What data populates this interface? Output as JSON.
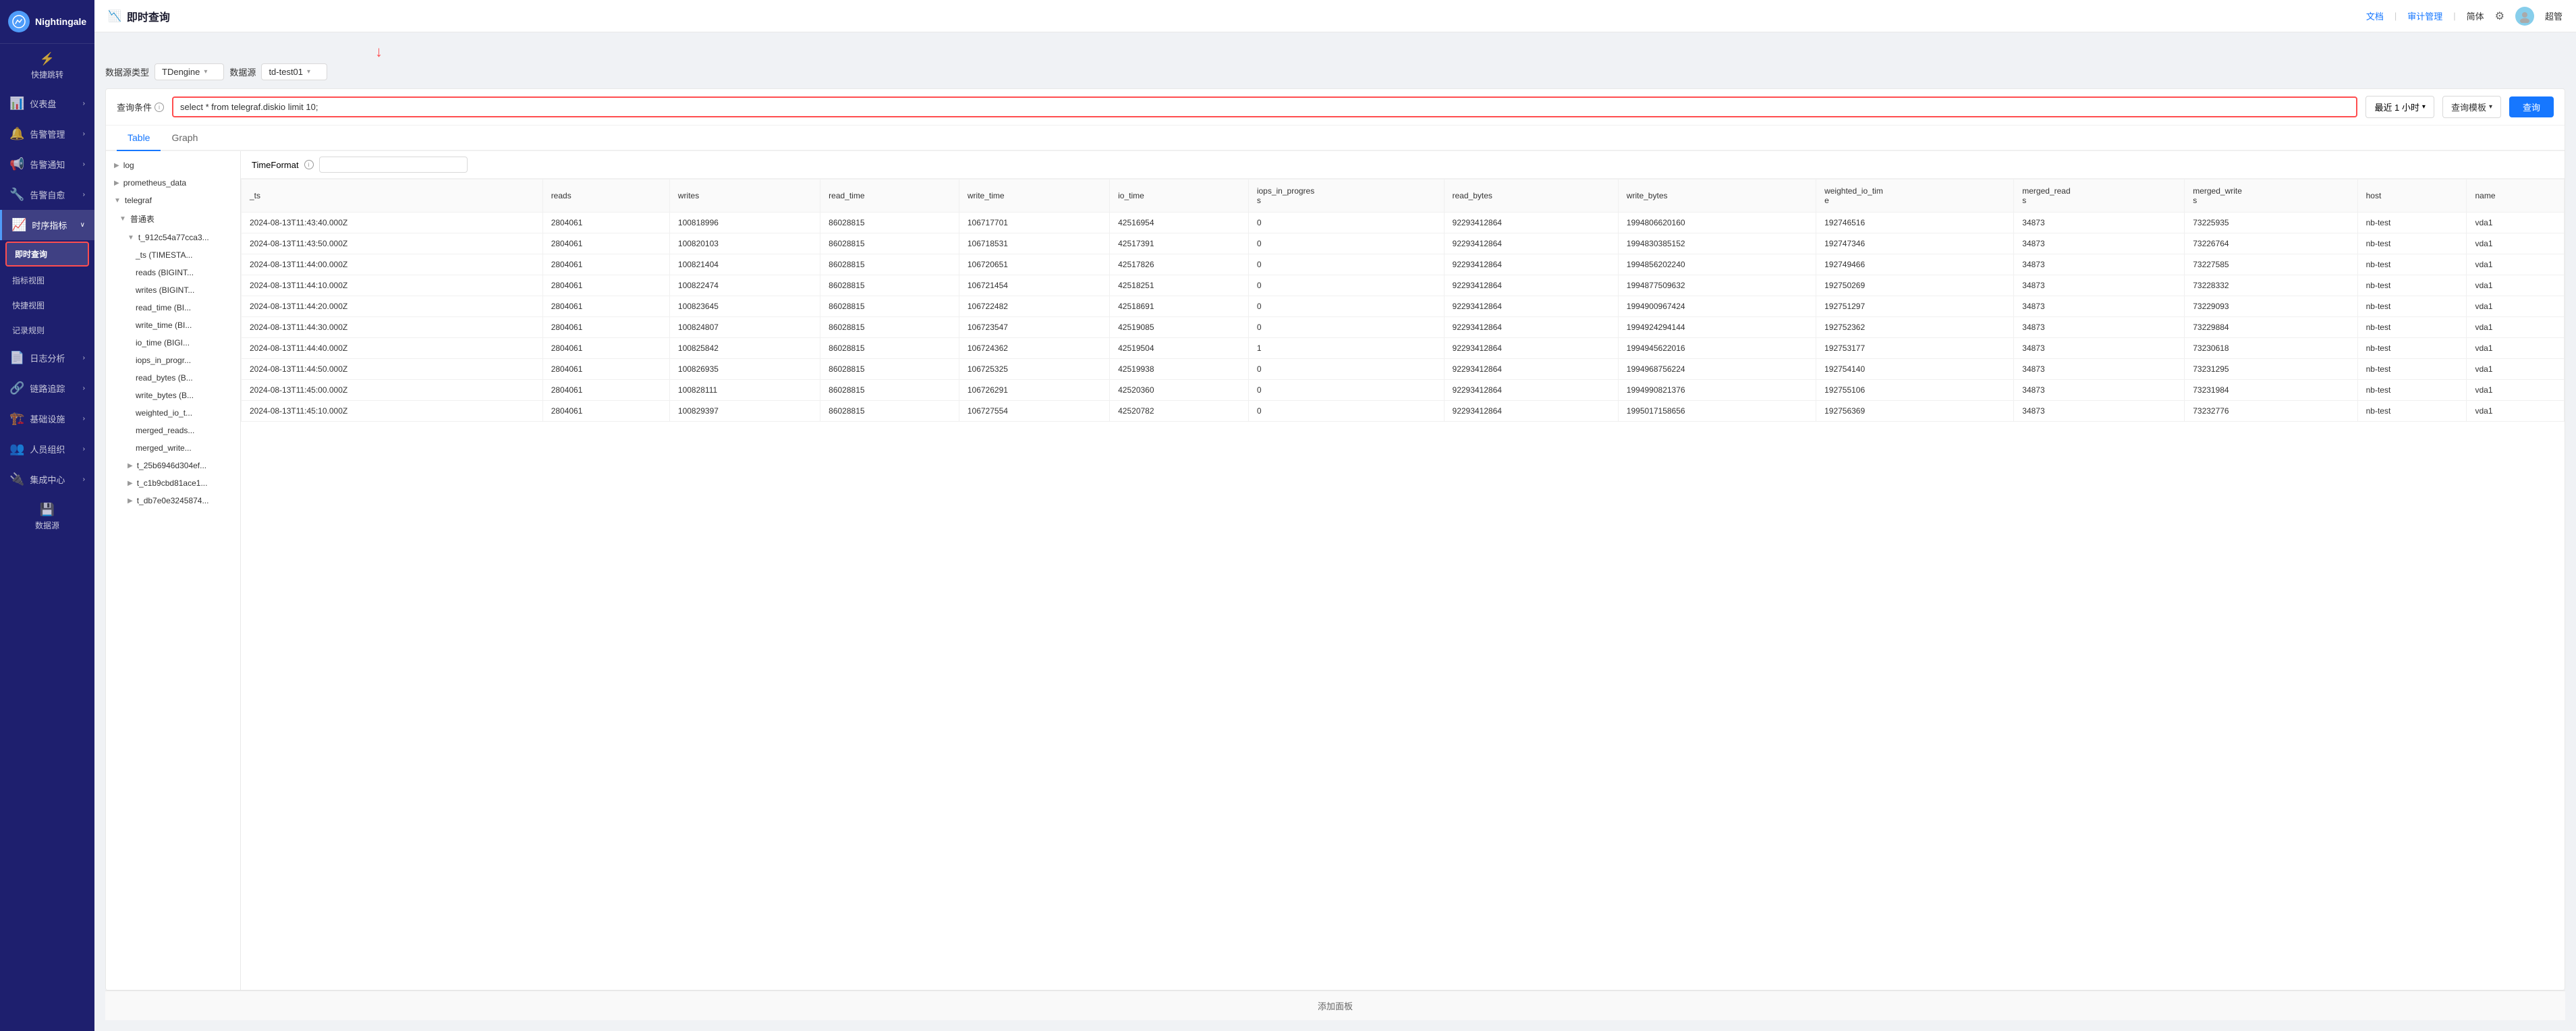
{
  "app": {
    "name": "Nightingale",
    "logo_letter": "N"
  },
  "sidebar": {
    "items": [
      {
        "id": "quick-jump",
        "label": "快捷跳转",
        "icon": "⚡",
        "active": false,
        "has_submenu": false
      },
      {
        "id": "dashboard",
        "label": "仪表盘",
        "icon": "📊",
        "active": false,
        "has_submenu": true
      },
      {
        "id": "alert-mgmt",
        "label": "告警管理",
        "icon": "🔔",
        "active": false,
        "has_submenu": true
      },
      {
        "id": "alert-notify",
        "label": "告警通知",
        "icon": "📢",
        "active": false,
        "has_submenu": true
      },
      {
        "id": "alert-self",
        "label": "告警自愈",
        "icon": "🔧",
        "active": false,
        "has_submenu": true
      },
      {
        "id": "timeseries",
        "label": "时序指标",
        "icon": "📈",
        "active": true,
        "has_submenu": true
      },
      {
        "id": "realtime-query",
        "label": "即时查询",
        "active": true,
        "submenu": true,
        "is_sub": true
      },
      {
        "id": "metric-view",
        "label": "指标视图",
        "active": false,
        "is_sub": true
      },
      {
        "id": "quick-view",
        "label": "快捷视图",
        "active": false,
        "is_sub": true
      },
      {
        "id": "record-rule",
        "label": "记录规则",
        "active": false,
        "is_sub": true
      },
      {
        "id": "log-analysis",
        "label": "日志分析",
        "icon": "📄",
        "active": false,
        "has_submenu": true
      },
      {
        "id": "trace",
        "label": "链路追踪",
        "icon": "🔗",
        "active": false,
        "has_submenu": true
      },
      {
        "id": "infra",
        "label": "基础设施",
        "icon": "🏗️",
        "active": false,
        "has_submenu": true
      },
      {
        "id": "personnel",
        "label": "人员组织",
        "icon": "👥",
        "active": false,
        "has_submenu": true
      },
      {
        "id": "integration",
        "label": "集成中心",
        "icon": "🔌",
        "active": false,
        "has_submenu": true
      },
      {
        "id": "datasource",
        "label": "数据源",
        "icon": "💾",
        "active": false,
        "has_submenu": false
      }
    ]
  },
  "topbar": {
    "title": "即时查询",
    "nav_links": [
      "文档",
      "审计管理"
    ],
    "lang": "简体",
    "settings_icon": "⚙",
    "username": "超管"
  },
  "toolbar": {
    "datasource_type_label": "数据源类型",
    "datasource_type_value": "TDengine",
    "datasource_label": "数据源",
    "datasource_value": "td-test01"
  },
  "query": {
    "condition_label": "查询条件",
    "condition_value": "select * from telegraf.diskio limit 10;",
    "time_range": "最近 1 小时",
    "template_btn": "查询模板",
    "query_btn": "查询"
  },
  "tabs": [
    {
      "id": "table",
      "label": "Table",
      "active": true
    },
    {
      "id": "graph",
      "label": "Graph",
      "active": false
    }
  ],
  "time_format": {
    "label": "TimeFormat",
    "value": ""
  },
  "tree": {
    "items": [
      {
        "label": "log",
        "level": 0,
        "expanded": false,
        "icon": "▶"
      },
      {
        "label": "prometheus_data",
        "level": 0,
        "expanded": false,
        "icon": "▶"
      },
      {
        "label": "telegraf",
        "level": 0,
        "expanded": true,
        "icon": "▼"
      },
      {
        "label": "普通表",
        "level": 1,
        "expanded": true,
        "icon": "▼"
      },
      {
        "label": "t_912c54a77cca3...",
        "level": 2,
        "expanded": true,
        "icon": "▼"
      },
      {
        "label": "_ts (TIMESTA...",
        "level": 3,
        "expanded": false,
        "icon": ""
      },
      {
        "label": "reads (BIGINT...",
        "level": 3,
        "expanded": false,
        "icon": ""
      },
      {
        "label": "writes (BIGINT...",
        "level": 3,
        "expanded": false,
        "icon": ""
      },
      {
        "label": "read_time (BI...",
        "level": 3,
        "expanded": false,
        "icon": ""
      },
      {
        "label": "write_time (BI...",
        "level": 3,
        "expanded": false,
        "icon": ""
      },
      {
        "label": "io_time (BIGI...",
        "level": 3,
        "expanded": false,
        "icon": ""
      },
      {
        "label": "iops_in_progr...",
        "level": 3,
        "expanded": false,
        "icon": ""
      },
      {
        "label": "read_bytes (B...",
        "level": 3,
        "expanded": false,
        "icon": ""
      },
      {
        "label": "write_bytes (B...",
        "level": 3,
        "expanded": false,
        "icon": ""
      },
      {
        "label": "weighted_io_t...",
        "level": 3,
        "expanded": false,
        "icon": ""
      },
      {
        "label": "merged_reads...",
        "level": 3,
        "expanded": false,
        "icon": ""
      },
      {
        "label": "merged_write...",
        "level": 3,
        "expanded": false,
        "icon": ""
      },
      {
        "label": "t_25b6946d304ef...",
        "level": 2,
        "expanded": false,
        "icon": "▶"
      },
      {
        "label": "t_c1b9cbd81ace1...",
        "level": 2,
        "expanded": false,
        "icon": "▶"
      },
      {
        "label": "t_db7e0e3245874...",
        "level": 2,
        "expanded": false,
        "icon": "▶"
      }
    ]
  },
  "table": {
    "columns": [
      "_ts",
      "reads",
      "writes",
      "read_time",
      "write_time",
      "io_time",
      "iops_in_progress",
      "read_bytes",
      "write_bytes",
      "weighted_io_time",
      "merged_reads",
      "merged_writes",
      "host",
      "name"
    ],
    "rows": [
      [
        "2024-08-13T11:43:40.000Z",
        "2804061",
        "100818996",
        "86028815",
        "106717701",
        "42516954",
        "0",
        "92293412864",
        "1994806620160",
        "192746516",
        "34873",
        "73225935",
        "nb-test",
        "vda1"
      ],
      [
        "2024-08-13T11:43:50.000Z",
        "2804061",
        "100820103",
        "86028815",
        "106718531",
        "42517391",
        "0",
        "92293412864",
        "1994830385152",
        "192747346",
        "34873",
        "73226764",
        "nb-test",
        "vda1"
      ],
      [
        "2024-08-13T11:44:00.000Z",
        "2804061",
        "100821404",
        "86028815",
        "106720651",
        "42517826",
        "0",
        "92293412864",
        "1994856202240",
        "192749466",
        "34873",
        "73227585",
        "nb-test",
        "vda1"
      ],
      [
        "2024-08-13T11:44:10.000Z",
        "2804061",
        "100822474",
        "86028815",
        "106721454",
        "42518251",
        "0",
        "92293412864",
        "1994877509632",
        "192750269",
        "34873",
        "73228332",
        "nb-test",
        "vda1"
      ],
      [
        "2024-08-13T11:44:20.000Z",
        "2804061",
        "100823645",
        "86028815",
        "106722482",
        "42518691",
        "0",
        "92293412864",
        "1994900967424",
        "192751297",
        "34873",
        "73229093",
        "nb-test",
        "vda1"
      ],
      [
        "2024-08-13T11:44:30.000Z",
        "2804061",
        "100824807",
        "86028815",
        "106723547",
        "42519085",
        "0",
        "92293412864",
        "1994924294144",
        "192752362",
        "34873",
        "73229884",
        "nb-test",
        "vda1"
      ],
      [
        "2024-08-13T11:44:40.000Z",
        "2804061",
        "100825842",
        "86028815",
        "106724362",
        "42519504",
        "1",
        "92293412864",
        "1994945622016",
        "192753177",
        "34873",
        "73230618",
        "nb-test",
        "vda1"
      ],
      [
        "2024-08-13T11:44:50.000Z",
        "2804061",
        "100826935",
        "86028815",
        "106725325",
        "42519938",
        "0",
        "92293412864",
        "1994968756224",
        "192754140",
        "34873",
        "73231295",
        "nb-test",
        "vda1"
      ],
      [
        "2024-08-13T11:45:00.000Z",
        "2804061",
        "100828111",
        "86028815",
        "106726291",
        "42520360",
        "0",
        "92293412864",
        "1994990821376",
        "192755106",
        "34873",
        "73231984",
        "nb-test",
        "vda1"
      ],
      [
        "2024-08-13T11:45:10.000Z",
        "2804061",
        "100829397",
        "86028815",
        "106727554",
        "42520782",
        "0",
        "92293412864",
        "1995017158656",
        "192756369",
        "34873",
        "73232776",
        "nb-test",
        "vda1"
      ]
    ]
  },
  "footer": {
    "add_panel": "添加面板"
  }
}
